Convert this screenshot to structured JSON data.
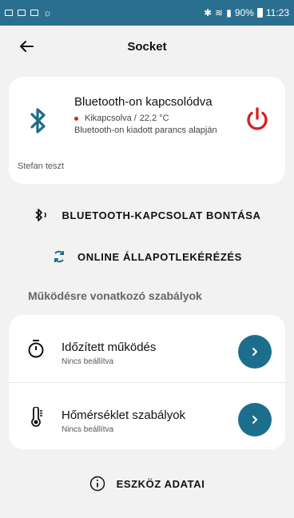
{
  "status_bar": {
    "battery": "90%",
    "time": "11:23"
  },
  "header": {
    "title": "Socket"
  },
  "device": {
    "name": "Bluetooth-on kapcsolódva",
    "state": "Kikapcsolva /",
    "temperature": "22.2 °C",
    "detail": "Bluetooth-on kiadott parancs alapján",
    "owner": "Stefan teszt",
    "colors": {
      "power": "#d32424",
      "bluetooth": "#1d6e8c"
    }
  },
  "actions": {
    "disconnect": "BLUETOOTH-KAPCSOLAT BONTÁSA",
    "online_query": "ONLINE ÁLLAPOTLEKÉRÉZÉS"
  },
  "rules_section": {
    "title": "Működésre vonatkozó szabályok",
    "items": [
      {
        "title": "Időzített működés",
        "subtitle": "Nincs beállítva",
        "icon": "stopwatch-icon"
      },
      {
        "title": "Hőmérséklet szabályok",
        "subtitle": "Nincs beállítva",
        "icon": "thermometer-icon"
      }
    ]
  },
  "footer": {
    "device_info": "ESZKÖZ ADATAI"
  }
}
